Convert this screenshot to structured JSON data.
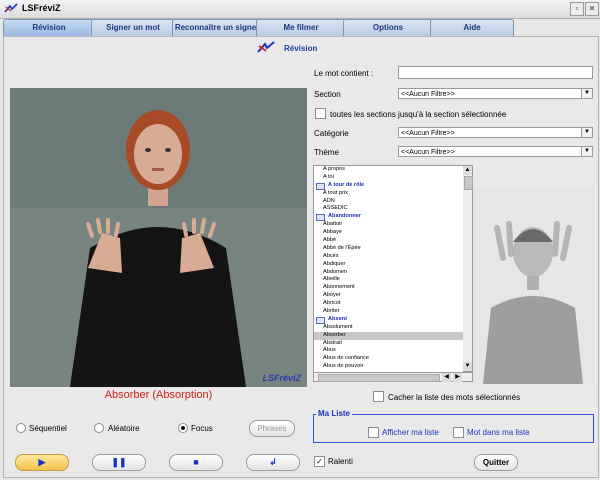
{
  "window": {
    "title": "LSFréviZ"
  },
  "tabs": [
    {
      "label": "Révision"
    },
    {
      "label": "Signer un mot"
    },
    {
      "label": "Reconnaître un signe"
    },
    {
      "label": "Me filmer"
    },
    {
      "label": "Options"
    },
    {
      "label": "Aide"
    }
  ],
  "header": {
    "title": "Révision"
  },
  "video": {
    "logo": "LSFréviZ",
    "caption": "Absorber (Absorption)"
  },
  "filters": {
    "contains_label": "Le mot contient :",
    "contains_value": "",
    "section_label": "Section",
    "section_value": "<<Aucun Filtre>>",
    "all_sections_label": "toutes les sections jusqu'à la section sélectionnée",
    "category_label": "Catégorie",
    "category_value": "<<Aucun Filtre>>",
    "theme_label": "Thème",
    "theme_value": "<<Aucun Filtre>>"
  },
  "word_list": [
    {
      "text": "A propos",
      "type": "item"
    },
    {
      "text": "A toi",
      "type": "item"
    },
    {
      "text": "A tour de rôle",
      "type": "group"
    },
    {
      "text": "A tout prix",
      "type": "item"
    },
    {
      "text": "ADN",
      "type": "item"
    },
    {
      "text": "ASSEDIC",
      "type": "item"
    },
    {
      "text": "Abandonner",
      "type": "group"
    },
    {
      "text": "Abattoir",
      "type": "item"
    },
    {
      "text": "Abbaye",
      "type": "item"
    },
    {
      "text": "Abbé",
      "type": "item"
    },
    {
      "text": "Abbé de l'Épée",
      "type": "item"
    },
    {
      "text": "Abcès",
      "type": "item"
    },
    {
      "text": "Abdiquer",
      "type": "item"
    },
    {
      "text": "Abdomen",
      "type": "item"
    },
    {
      "text": "Abeille",
      "type": "item"
    },
    {
      "text": "Abonnement",
      "type": "item"
    },
    {
      "text": "Aboyer",
      "type": "item"
    },
    {
      "text": "Abricot",
      "type": "item"
    },
    {
      "text": "Abriter",
      "type": "item"
    },
    {
      "text": "Absent",
      "type": "group"
    },
    {
      "text": "Absolument",
      "type": "item"
    },
    {
      "text": "Absorber",
      "type": "selected"
    },
    {
      "text": "Abstrait",
      "type": "item"
    },
    {
      "text": "Abus",
      "type": "item"
    },
    {
      "text": "Abus de confiance",
      "type": "item"
    },
    {
      "text": "Abus de pouvoir",
      "type": "item"
    }
  ],
  "hide_selected_label": "Cacher la liste des mots sélectionnés",
  "modes": {
    "sequential": "Séquentiel",
    "random": "Aléatoire",
    "focus": "Focus",
    "selected": "focus"
  },
  "phrases_button": "Phrases",
  "ma_liste": {
    "title": "Ma Liste",
    "show_label": "Afficher ma liste",
    "word_in_list_label": "Mot dans ma liste"
  },
  "ralenti_label": "Ralenti",
  "quit_button": "Quitter",
  "colors": {
    "accent_blue": "#1b35c0",
    "caption_red": "#d0221b",
    "play_gold": "#f3c34e"
  },
  "icons": {
    "play": "play-icon",
    "pause": "pause-icon",
    "stop": "stop-icon",
    "replay": "replay-icon"
  }
}
